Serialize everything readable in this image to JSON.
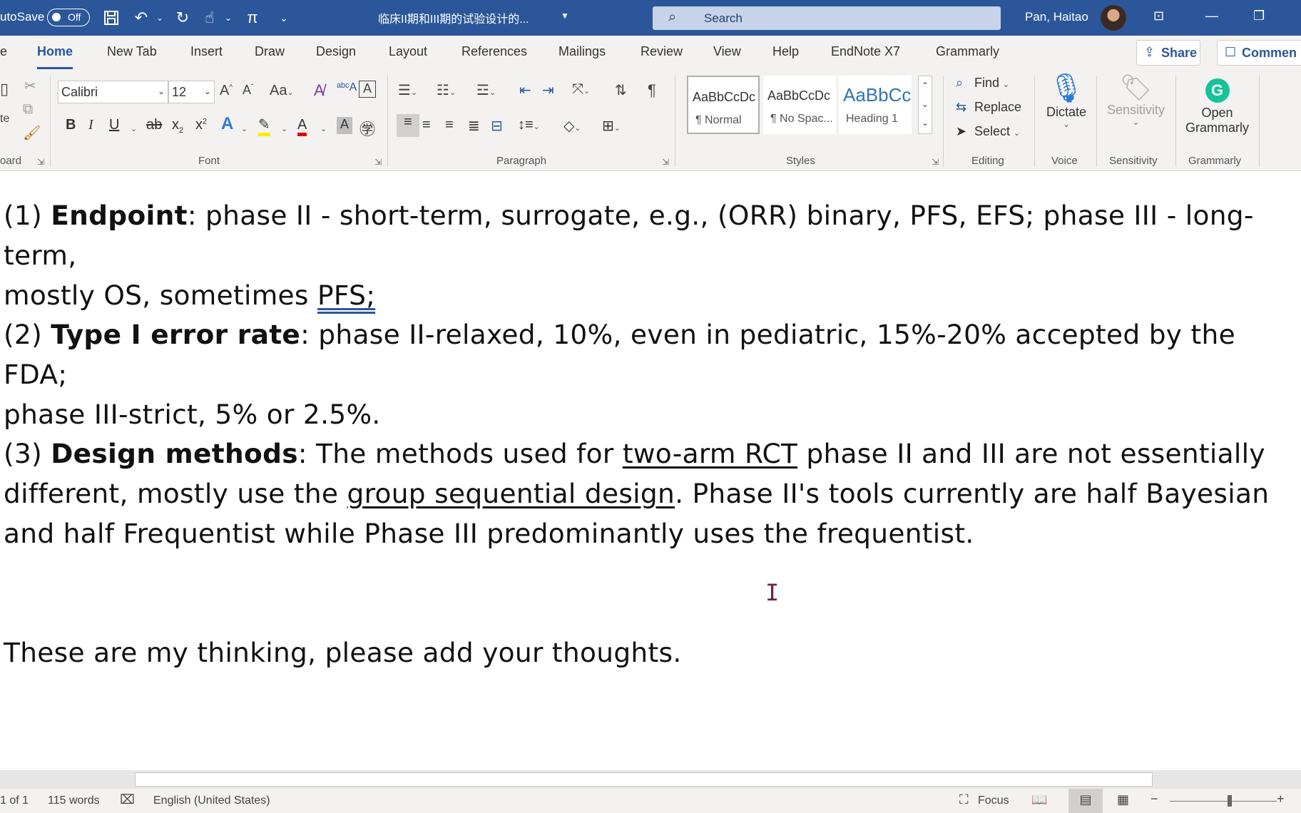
{
  "titlebar": {
    "autosave_label": "utoSave",
    "autosave_state": "Off",
    "document_title": "临床II期和III期的试验设计的...",
    "search_placeholder": "Search",
    "user_name": "Pan, Haitao"
  },
  "tabs": [
    "e",
    "Home",
    "New Tab",
    "Insert",
    "Draw",
    "Design",
    "Layout",
    "References",
    "Mailings",
    "Review",
    "View",
    "Help",
    "EndNote X7",
    "Grammarly"
  ],
  "share_label": "Share",
  "comments_label": "Commen",
  "ribbon": {
    "clipboard_label": "oard",
    "paste_label": "te",
    "font_name": "Calibri",
    "font_size": "12",
    "font_label": "Font",
    "paragraph_label": "Paragraph",
    "styles_label": "Styles",
    "styles": [
      {
        "sample": "AaBbCcDc",
        "name": "¶ Normal"
      },
      {
        "sample": "AaBbCcDc",
        "name": "¶ No Spac..."
      },
      {
        "sample": "AaBbCc",
        "name": "Heading 1"
      }
    ],
    "heading_color": "#2e74b5",
    "find_label": "Find",
    "replace_label": "Replace",
    "select_label": "Select",
    "editing_label": "Editing",
    "dictate_label": "Dictate",
    "voice_label": "Voice",
    "sensitivity_btn": "Sensitivity",
    "sensitivity_label": "Sensitivity",
    "grammarly_btn_line1": "Open",
    "grammarly_btn_line2": "Grammarly",
    "grammarly_label": "Grammarly"
  },
  "document": {
    "p1": {
      "num": "(1) ",
      "bold": "Endpoint",
      "text_a": ": phase II - short-term, surrogate, e.g., (ORR) binary, PFS, EFS; phase III - long-term,",
      "text_b": "mostly OS, sometimes ",
      "underlined": "PFS;"
    },
    "p2": {
      "num": "(2) ",
      "bold": "Type I error rate",
      "text_a": ": phase II-relaxed, 10%, even in pediatric, 15%-20% accepted by the FDA;",
      "text_b": "phase III-strict, 5% or 2.5%."
    },
    "p3": {
      "num": "(3) ",
      "bold": "Design methods",
      "text_a": ": The methods used for ",
      "link_a": "two-arm RCT",
      "text_b": " phase II and III are not essentially",
      "text_c": "different, mostly use the ",
      "link_b": "group sequential design",
      "text_d": ". Phase II's tools currently are half Bayesian",
      "text_e": "and half Frequentist while Phase III predominantly uses the frequentist."
    },
    "p4": "These are my thinking, please add your thoughts."
  },
  "status": {
    "page": "1 of 1",
    "words": "115 words",
    "language": "English (United States)",
    "focus": "Focus"
  },
  "colors": {
    "title_bar": "#2b579a",
    "ribbon_bg": "#f3f2f1"
  }
}
